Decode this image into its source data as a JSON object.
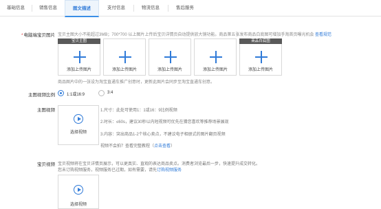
{
  "tabs": [
    {
      "label": "基础信息"
    },
    {
      "label": "销售信息"
    },
    {
      "label": "图文描述",
      "active": true
    },
    {
      "label": "支付信息"
    },
    {
      "label": "物流信息"
    },
    {
      "label": "售后服务"
    }
  ],
  "main_images": {
    "label": "电脑端宝贝图片",
    "required_mark": "*",
    "hint": "宝贝主图大小不能超过3MB；700*700 以上图片上传后宝贝详情页自动提供放大镜功能。商品第五张发布商品白底图可增加手淘首页曝光机会",
    "hint_link": "查看规范",
    "slots": [
      {
        "caption": "宝贝主图",
        "label": "添加上传图片"
      },
      {
        "caption": "",
        "label": "添加上传图片"
      },
      {
        "caption": "",
        "label": "添加上传图片"
      },
      {
        "caption": "",
        "label": "添加上传图片"
      },
      {
        "caption": "商品白底图",
        "label": "添加上传图片"
      }
    ],
    "footnote": "商品图片中的一张设为淘宝直通车推广创意时，更新此图片会同步至淘宝直通车创意。"
  },
  "ratio": {
    "label": "主图视频比例",
    "options": [
      {
        "label": "1:1或16:9",
        "checked": true
      },
      {
        "label": "3:4",
        "checked": false
      }
    ]
  },
  "main_video": {
    "label": "主图视频",
    "button_label": "选择视频",
    "tips": [
      "1.尺寸：此处可使用1：1或16：9比例视频",
      "2.时长：≤60s，建议30秒以内短视频可优先在猜您喜欢等推荐场景展现",
      "3.内容：突出商品1-2个核心卖点，不建议电子相册式的图片翻页视频"
    ],
    "help_text": "视频不会拍？查看完整教程（",
    "help_link": "点击查看",
    "help_suffix": "）"
  },
  "detail_video": {
    "label": "宝贝视频",
    "desc_line1": "宝贝视频将在宝贝详情页展示，可以更真实、直观的表达商品卖点。消费者浏览最后一步，快速提升成交转化。",
    "desc_line2_text": "您未订购视频服务，视频服务已过期，如有需要，请先",
    "desc_line2_link": "订购视频服务",
    "button_label": "选择视频"
  }
}
